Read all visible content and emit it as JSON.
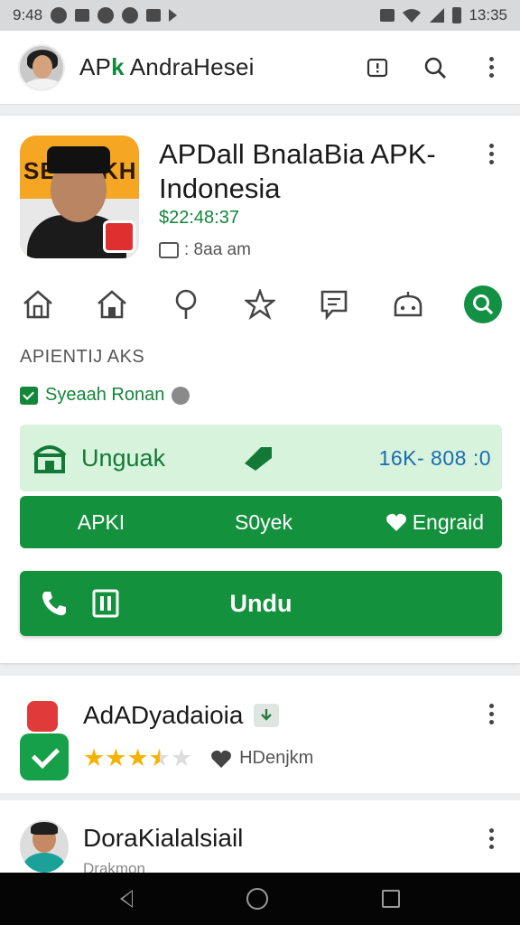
{
  "status_bar": {
    "time_left": "9:48",
    "time_right": "13:35"
  },
  "app_bar": {
    "title_prefix": "AP",
    "title_k": "k",
    "title_rest": " AndraHesei",
    "icons": [
      "account-avatar",
      "info-icon",
      "search-icon",
      "more-vert-icon"
    ]
  },
  "featured": {
    "title_line1": "APDall BnalaBia APK-",
    "title_line2": "Indonesia",
    "price": "$22:48:37",
    "meta": ": 8aa am",
    "icons": [
      "home-outline-icon",
      "home-icon",
      "location-pin-icon",
      "star-icon",
      "comment-icon",
      "android-icon",
      "search-badge-icon"
    ],
    "section_label": "APIENTIJ AKS",
    "verified_label": "Syeaah Ronan",
    "stat": {
      "label": "Unguak",
      "size": "16K- 808 :0"
    },
    "tabs": {
      "t1": "APKI",
      "t2": "S0yek",
      "t3": "Engraid"
    },
    "download_label": "Undu",
    "colors": {
      "accent": "#14913d",
      "stat_bg": "#d7f3dc",
      "size_text": "#1a6cb0"
    }
  },
  "list": [
    {
      "title": "AdADyadaioia",
      "rating_stars": 3.5,
      "rating_max": 5,
      "fav_label": "HDenjkm"
    },
    {
      "title": "DoraKialalsiail",
      "subtitle": "Drakmon"
    }
  ]
}
